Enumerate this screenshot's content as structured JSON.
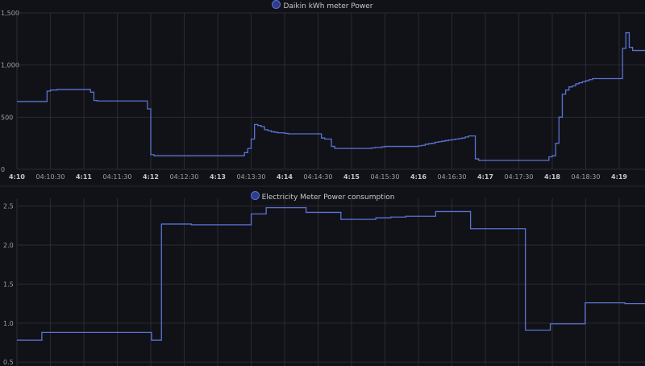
{
  "theme": {
    "background": "#111217",
    "grid": "#2a2b30",
    "line": "#5b72d6",
    "swatch_fill": "#2f3c8a"
  },
  "panels": {
    "top": {
      "legend": "Daikin kWh meter Power"
    },
    "bottom": {
      "legend": "Electricity Meter Power consumption"
    }
  },
  "chart_data": [
    {
      "type": "line",
      "title": "",
      "series": [
        {
          "name": "Daikin kWh meter Power",
          "color": "#5b72d6"
        }
      ],
      "ylim": [
        0,
        1500
      ],
      "y_ticks": [
        "0",
        "500",
        "1,000",
        "1,500"
      ],
      "x_ticks": [
        {
          "label": "4:10",
          "bold": true
        },
        {
          "label": "04:10:30",
          "bold": false
        },
        {
          "label": "4:11",
          "bold": true
        },
        {
          "label": "04:11:30",
          "bold": false
        },
        {
          "label": "4:12",
          "bold": true
        },
        {
          "label": "04:12:30",
          "bold": false
        },
        {
          "label": "4:13",
          "bold": true
        },
        {
          "label": "04:13:30",
          "bold": false
        },
        {
          "label": "4:14",
          "bold": true
        },
        {
          "label": "04:14:30",
          "bold": false
        },
        {
          "label": "4:15",
          "bold": true
        },
        {
          "label": "04:15:30",
          "bold": false
        },
        {
          "label": "4:16",
          "bold": true
        },
        {
          "label": "04:16:30",
          "bold": false
        },
        {
          "label": "4:17",
          "bold": true
        },
        {
          "label": "04:17:30",
          "bold": false
        },
        {
          "label": "4:18",
          "bold": true
        },
        {
          "label": "04:18:30",
          "bold": false
        },
        {
          "label": "4:19",
          "bold": true
        }
      ],
      "x_step_seconds": [
        0,
        3,
        6,
        9,
        12,
        15,
        18,
        21,
        24,
        27,
        30,
        33,
        36,
        39,
        42,
        45,
        48,
        51,
        54,
        57,
        60,
        63,
        66,
        69,
        72,
        75,
        78,
        81,
        84,
        87,
        90,
        93,
        96,
        99,
        102,
        105,
        108,
        111,
        114,
        117,
        120,
        123,
        126,
        129,
        132,
        135,
        138,
        141,
        144,
        147,
        150,
        153,
        156,
        159,
        162,
        165,
        168,
        171,
        174,
        177,
        180,
        183,
        186,
        189,
        192,
        195,
        198,
        201,
        204,
        207,
        210,
        213,
        216,
        219,
        222,
        225,
        228,
        231,
        234,
        237,
        240,
        243,
        246,
        249,
        252,
        255,
        258,
        261,
        264,
        267,
        270,
        273,
        276,
        279,
        282,
        285,
        288,
        291,
        294,
        297,
        300,
        303,
        306,
        309,
        312,
        315,
        318,
        321,
        324,
        327,
        330,
        333,
        336,
        339,
        342,
        345,
        348,
        351,
        354,
        357,
        360,
        363,
        366,
        369,
        372,
        375,
        378,
        381,
        384,
        387,
        390,
        393,
        396,
        399,
        402,
        405,
        408,
        411,
        414,
        417,
        420,
        423,
        426,
        429,
        432,
        435,
        438,
        441,
        444,
        447,
        450,
        453,
        456,
        459,
        462,
        465,
        468,
        471,
        474,
        477,
        480,
        483,
        486,
        489,
        492,
        495,
        498,
        501,
        504,
        507,
        510,
        513,
        516,
        519,
        522,
        525,
        528,
        531,
        534,
        537,
        540,
        543,
        546,
        549,
        552,
        555,
        558
      ],
      "values": [
        650,
        650,
        650,
        650,
        650,
        650,
        650,
        650,
        650,
        750,
        760,
        760,
        765,
        765,
        765,
        765,
        765,
        765,
        765,
        765,
        765,
        765,
        740,
        660,
        655,
        655,
        655,
        655,
        655,
        655,
        655,
        655,
        655,
        655,
        655,
        655,
        655,
        655,
        655,
        580,
        140,
        130,
        130,
        130,
        130,
        130,
        130,
        130,
        130,
        130,
        130,
        130,
        130,
        130,
        130,
        130,
        130,
        130,
        130,
        130,
        130,
        130,
        130,
        130,
        130,
        130,
        130,
        130,
        160,
        200,
        290,
        430,
        420,
        410,
        380,
        370,
        360,
        355,
        350,
        350,
        345,
        340,
        340,
        340,
        340,
        340,
        340,
        340,
        340,
        340,
        340,
        300,
        290,
        290,
        220,
        200,
        200,
        200,
        200,
        200,
        200,
        200,
        200,
        200,
        200,
        200,
        205,
        210,
        210,
        215,
        220,
        220,
        220,
        220,
        220,
        220,
        220,
        220,
        220,
        220,
        225,
        230,
        240,
        245,
        250,
        260,
        265,
        270,
        275,
        280,
        285,
        290,
        295,
        300,
        310,
        320,
        320,
        100,
        85,
        85,
        85,
        85,
        85,
        85,
        85,
        85,
        85,
        85,
        85,
        85,
        85,
        85,
        85,
        85,
        85,
        85,
        85,
        85,
        85,
        120,
        130,
        250,
        500,
        720,
        760,
        790,
        800,
        820,
        830,
        840,
        850,
        860,
        870,
        870,
        870,
        870,
        870,
        870,
        870,
        870,
        870,
        1160,
        1310,
        1170,
        1140,
        1140,
        1140,
        1140,
        1140,
        1140,
        1130,
        1130,
        1130,
        1130
      ]
    },
    {
      "type": "line",
      "title": "",
      "series": [
        {
          "name": "Electricity Meter Power consumption",
          "color": "#5b72d6"
        }
      ],
      "ylim": [
        0.45,
        2.6
      ],
      "y_ticks": [
        "0.5",
        "1.0",
        "1.5",
        "2.0",
        "2.5"
      ],
      "x": [
        0,
        5,
        10,
        18,
        25,
        27,
        29,
        35,
        40,
        47,
        50,
        58,
        65,
        72,
        75,
        78,
        84,
        91,
        98,
        102,
        107,
        110,
        114,
        118,
        122,
        126
      ],
      "values": [
        0.78,
        0.88,
        0.88,
        0.88,
        0.88,
        0.78,
        2.27,
        2.26,
        2.26,
        2.4,
        2.48,
        2.42,
        2.33,
        2.35,
        2.36,
        2.37,
        2.43,
        2.21,
        2.21,
        0.91,
        0.99,
        0.99,
        1.26,
        1.26,
        1.25,
        1.25
      ]
    }
  ]
}
